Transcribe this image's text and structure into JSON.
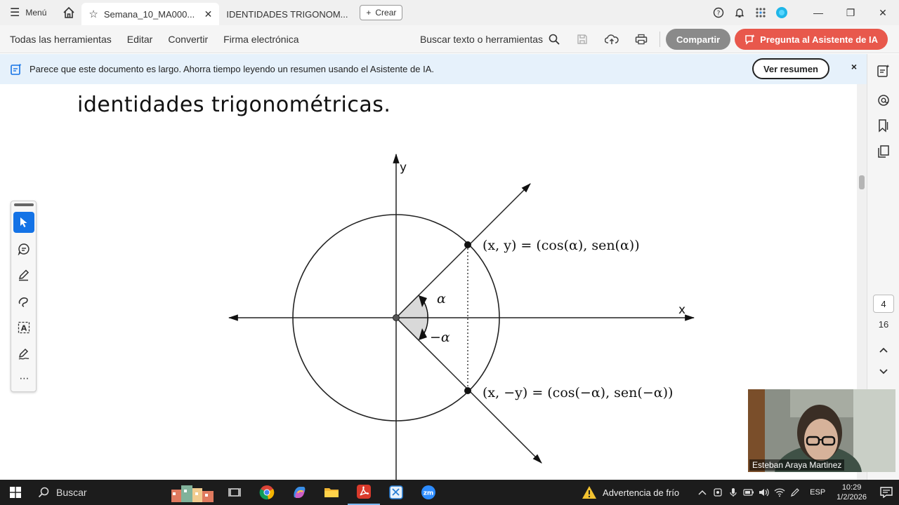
{
  "titlebar": {
    "menu_label": "Menú",
    "tabs": [
      {
        "title": "Semana_10_MA000...",
        "active": true
      },
      {
        "title": "IDENTIDADES TRIGONOM...",
        "active": false
      }
    ],
    "new_label": "Crear"
  },
  "toolbar": {
    "menus": [
      "Todas las herramientas",
      "Editar",
      "Convertir",
      "Firma electrónica"
    ],
    "search_label": "Buscar texto o herramientas",
    "share_label": "Compartir",
    "ai_label": "Pregunta al Asistente de IA"
  },
  "banner": {
    "text": "Parece que este documento es largo. Ahorra tiempo leyendo un resumen usando el Asistente de IA.",
    "button_label": "Ver resumen",
    "close_label": "×"
  },
  "document": {
    "heading": "identidades trigonométricas.",
    "diagram": {
      "axis_x_label": "x",
      "axis_y_label": "y",
      "angle_label": "α",
      "neg_angle_label": "−α",
      "upper_point_label": "(x, y) = (cos(α), sen(α))",
      "lower_point_label": "(x, −y) = (cos(−α), sen(−α))"
    }
  },
  "navigation": {
    "current_page": "4",
    "total_pages": "16"
  },
  "webcam": {
    "name": "Esteban Araya Martinez"
  },
  "taskbar": {
    "search_label": "Buscar",
    "weather_label": "Advertencia de frío",
    "language": "ESP",
    "time": "10:29",
    "date": "1/2/2026"
  },
  "colors": {
    "accent_blue": "#1473e6",
    "ai_button": "#e8584c",
    "share_button": "#8a8a8a",
    "banner_bg": "#e6f1fb"
  }
}
